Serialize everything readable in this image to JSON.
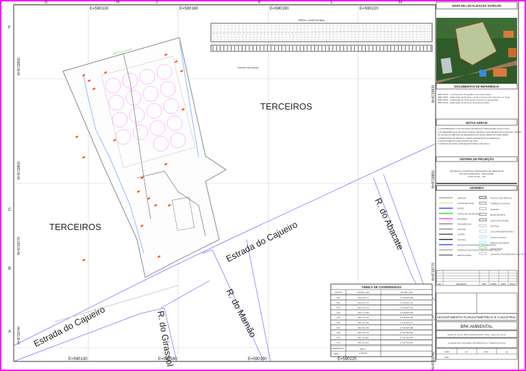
{
  "grid": {
    "columns": [
      "G",
      "H",
      "J",
      "K",
      "L",
      "M"
    ],
    "rows": [
      "F",
      "C",
      "B",
      "A"
    ],
    "eastings": [
      "E=590130",
      "E=590160",
      "E=590190",
      "E=590220"
    ],
    "northings": [
      "N=9718830",
      "N=9718800",
      "N=9718770",
      "N=9718740"
    ]
  },
  "map": {
    "neighbors": [
      "TERCEIROS",
      "TERCEIROS"
    ],
    "roads": [
      "Estrada do Cajueiro",
      "Estrada do Cajueiro",
      "R. do Abacate",
      "R. do Mamão",
      "R. do Girassol"
    ],
    "profile_title": "PERFIL LONGITUDINAL",
    "north_label": "NORTE DA QUADRA",
    "gate_label": "PORTÃO DE ACESSO"
  },
  "coord_table": {
    "title": "TABELA DE COORDENADAS",
    "headers": [
      "PONTO",
      "COORD. E(m)",
      "COORD. N(m)"
    ],
    "rows": [
      [
        "V01",
        "590.142.6 7",
        "9.718.832.358"
      ],
      [
        "V02",
        "590.163.723",
        "9.718.830.213"
      ],
      [
        "V03",
        "590.175.275",
        "9.718.810.635"
      ],
      [
        "V04",
        "590.171.843",
        "9.718.806.520"
      ],
      [
        "V05",
        "590.171.744",
        "9.718.805.786"
      ],
      [
        "V06",
        "590.155.835",
        "9.718.806.071"
      ],
      [
        "V07",
        "590.151.276",
        "9.718.805.188"
      ],
      [
        "V08",
        "590.133.743",
        "9.718.780.385"
      ],
      [
        "V09",
        "590.130.857",
        "9.718.780.049"
      ],
      [
        "V10",
        "590.133.613",
        "9.718.763.893"
      ]
    ],
    "perimeter_label": "PERÍMETRO",
    "perimeter_value": "588,71",
    "area_label": "ÁREA",
    "area_value": "2.283,00"
  },
  "panel": {
    "satellite_title": "MAPA DE LOCALIZAÇÃO SATÉLITE",
    "references_title": "DOCUMENTOS DE REFERÊNCIA",
    "references": [
      "NBR 13133 - Levantamento Topográfico Georreferenciado",
      "NBR 13531 - Elaboração de Projetos e Outros Documentos Técnicos em Geral",
      "NBR 10582 - Codificação de Documentos Técnicos de Engenharia",
      "NBR 14166 - Elaboração de Serviços Georreferenciados"
    ],
    "notes_title": "NOTAS GERAIS",
    "notes": [
      "1-COORDENADAS UTM SISTEMA GEODÉSICO SIRGAS2000 FUSO 24 SUL.",
      "2-AS REFERÊNCIAS DE NÍVEL FORAM OBTIDAS COM RECEPTOR GNSS RTK, SENDO",
      "AS COTAS ALTIMÉTRICAS REFERIDAS AO NÍVEL MÉDIO DO MAR (IBGE).",
      "3-DIMENSÕES EM METROS, ÁREAS EM METROS QUADRADOS.",
      "4-LEVANTAMENTO EXECUTADO EM 2021.",
      "5-CURVAS DE NÍVEL COM EQUIDISTÂNCIA DE 0,50 m."
    ],
    "projection_title": "SISTEMA DE PROJEÇÃO",
    "projection_lines": [
      "PROJEÇÃO UNIVERSAL TRANSVERSA DE MERCATOR",
      "DATUM HORIZONTAL: SIRGAS2000",
      "FUSO 24 SUL - MC"
    ],
    "legend_title": "LEGENDA",
    "legend_left": [
      "ADMATE",
      "CURVA DE NÍVEL",
      "MURO",
      "LIMITE DE VEGETAÇÃO",
      "ESTRADA",
      "RESIDÊNCIAS",
      "TALUDE",
      "CORTE",
      "POSTES",
      "RODOVIAS ESTRADAS PAVIMENTADAS",
      "FERROVIA ESTRADAS SEM PAVIMENTAÇÃO",
      "EDIFICAÇÕES"
    ],
    "legend_right": [
      "PONTOS DE VÉRTICE",
      "TERRENO NATURAL",
      "GRADES",
      "BASE GPS/RTK",
      "CERCA DE ARAME",
      "PONTES",
      "LAGOA/RESERVATÓRIO",
      "CAIXAS D'ÁGUA",
      "ÁREAS ALAGADAS",
      "VEGETAÇÃO",
      "LINHA DE TRANSMISSÃO ALTA TENSÃO"
    ],
    "revision_headers": [
      "REV.",
      "DESCRIÇÃO",
      "DATA",
      "DESEN.",
      "VERIF.",
      "APROV."
    ],
    "survey_title": "LEVANTAMENTO PLANIALTIMÉTRICO E CADASTRAL",
    "client": "BRK AMBIENTAL",
    "property": "Rótulo do Imóvel: BRK Residencial Eco Verde - Paço do Lumiar",
    "description": "Levantamento Topográfico Planialtimétrico e Cadastral da Área",
    "footer": [
      "1:500",
      "A3",
      "2021",
      "01",
      "R00"
    ]
  },
  "colors": {
    "frame": "#ff00ff",
    "road": "#6b6bff",
    "boundary": "#888888",
    "circles": "#ff66ff",
    "marker": "#ff4400",
    "green": "#33dd33"
  }
}
